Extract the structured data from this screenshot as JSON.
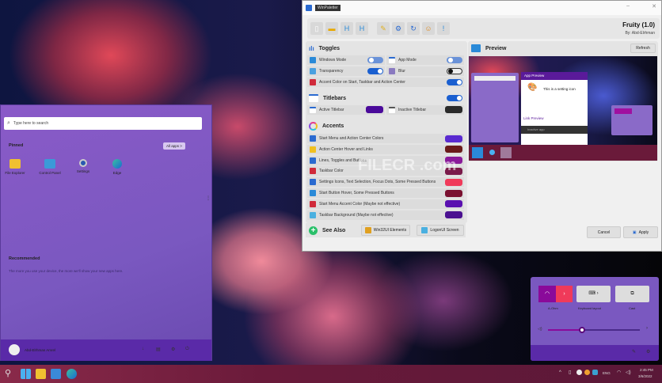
{
  "app": {
    "window_title": "WinPaletter",
    "name": "Fruity (1.0)",
    "author": "By: Abd-Elrhman",
    "toolbar": [
      "new-file",
      "open-folder",
      "save",
      "save-as",
      "edit",
      "settings",
      "refresh",
      "user",
      "info"
    ],
    "toggles": {
      "title": "Toggles",
      "windows_mode": "Windows Mode",
      "app_mode": "App Mode",
      "transparency": "Transparency",
      "blur": "Blur",
      "accent_on": "Accent Color on Start, Taskbar and Action Center"
    },
    "titlebars": {
      "title": "Titlebars",
      "active": "Active Titlebar",
      "inactive": "Inactive Titlebar",
      "active_color": "#4a0a9a",
      "inactive_color": "#2a2a2a"
    },
    "accents": {
      "title": "Accents",
      "items": [
        {
          "label": "Start Menu and Action Center Colors",
          "color": "#5a2ad0"
        },
        {
          "label": "Action Center Hover and Links",
          "color": "#6a1a1a"
        },
        {
          "label": "Lines, Toggles and Buttons",
          "color": "#8a1a9a"
        },
        {
          "label": "Taskbar Color",
          "color": "#7a1a4a"
        },
        {
          "label": "Settings Icons, Text Selection, Focus Dots, Some Pressed Buttons",
          "color": "#f03a5a"
        },
        {
          "label": "Start Button Hover, Some Pressed Buttons",
          "color": "#7a1030"
        },
        {
          "label": "Start Menu Accent Color (Maybe not effective)",
          "color": "#5a10b0"
        },
        {
          "label": "Taskbar Background (Maybe not effective)",
          "color": "#4a1090"
        }
      ]
    },
    "see_also": {
      "title": "See Also",
      "win32": "Win32UI Elements",
      "logon": "LogonUI Screen"
    },
    "preview": {
      "title": "Preview",
      "refresh": "Refresh",
      "app_preview": "App Preview",
      "setting_icon_text": "This is a setting icon",
      "link_preview": "Link Preview",
      "inactive_app": "Inactive app"
    },
    "cancel": "Cancel",
    "apply": "Apply"
  },
  "start": {
    "search_placeholder": "Type here to search",
    "pinned": "Pinned",
    "all_apps": "All apps  >",
    "pins": [
      "File Explorer",
      "Control Panel",
      "Settings",
      "Edge"
    ],
    "recommended": "Recommended",
    "recommended_text": "The more you use your device, the more we'll show your new apps here.",
    "user": "Abd-Elrhman Amrel"
  },
  "quick": {
    "wifi": "A-Ohm",
    "keyboard": "Keyboard layout",
    "cast": "Cast",
    "volume": 0.37
  },
  "taskbar": {
    "lang": "ENG",
    "time": "2:45 PM",
    "date": "3/6/2022"
  },
  "watermark": "FILECR .com"
}
